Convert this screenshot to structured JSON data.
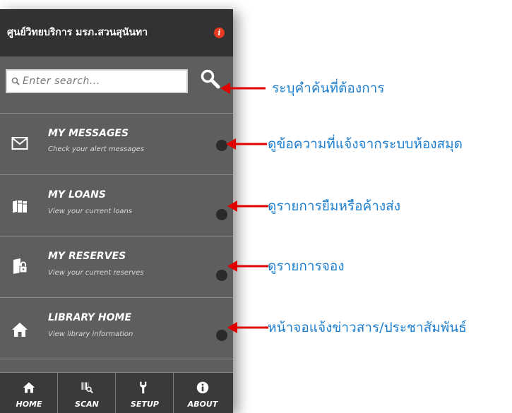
{
  "app": {
    "title": "ศูนย์วิทยบริการ มรภ.สวนสุนันทา",
    "accent_color": "#e83a20",
    "info_icon": "info-icon"
  },
  "search": {
    "placeholder": "Enter search...",
    "value": "",
    "search_icon": "magnifier-icon"
  },
  "menu": {
    "items": [
      {
        "title": "MY MESSAGES",
        "subtitle": "Check your alert messages",
        "icon": "envelope-icon"
      },
      {
        "title": "MY LOANS",
        "subtitle": "View your current loans",
        "icon": "books-icon"
      },
      {
        "title": "MY RESERVES",
        "subtitle": "View your current reserves",
        "icon": "book-lock-icon"
      },
      {
        "title": "LIBRARY HOME",
        "subtitle": "View library information",
        "icon": "home-icon"
      }
    ]
  },
  "bottom_nav": {
    "items": [
      {
        "label": "HOME",
        "icon": "home-icon"
      },
      {
        "label": "SCAN",
        "icon": "barcode-scan-icon"
      },
      {
        "label": "SETUP",
        "icon": "wrench-icon"
      },
      {
        "label": "ABOUT",
        "icon": "info-icon"
      }
    ]
  },
  "annotations": {
    "arrow_color": "#e00000",
    "text_color": "#1f7fcf",
    "items": [
      "ระบุคำค้นที่ต้องการ",
      "ดูข้อความที่แจ้งจากระบบห้องสมุด",
      "ดูรายการยืมหรือค้างส่ง",
      "ดูรายการจอง",
      "หน้าจอแจ้งข่าวสาร/ประชาสัมพันธ์"
    ]
  }
}
